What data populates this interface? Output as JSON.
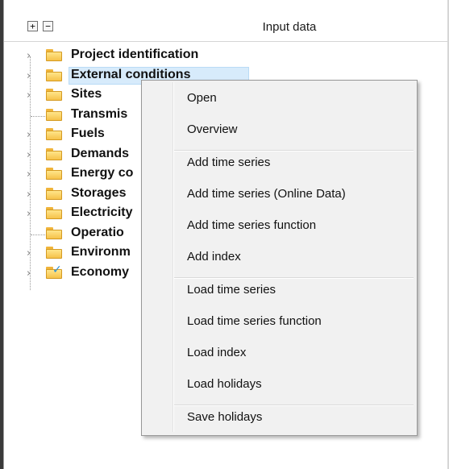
{
  "header": {
    "title": "Input data",
    "expand_label": "+",
    "collapse_label": "−"
  },
  "tree": [
    {
      "label": "Project identification",
      "expandable": true,
      "icon": "folder-icon",
      "selected": false
    },
    {
      "label": "External conditions",
      "expandable": true,
      "icon": "folder-icon",
      "selected": true
    },
    {
      "label": "Sites",
      "expandable": true,
      "icon": "folder-icon",
      "selected": false
    },
    {
      "label": "Transmis",
      "expandable": false,
      "icon": "folder-icon",
      "selected": false
    },
    {
      "label": "Fuels",
      "expandable": true,
      "icon": "folder-icon",
      "selected": false
    },
    {
      "label": "Demands",
      "expandable": true,
      "icon": "folder-icon",
      "selected": false
    },
    {
      "label": "Energy co",
      "expandable": true,
      "icon": "folder-icon",
      "selected": false
    },
    {
      "label": "Storages",
      "expandable": true,
      "icon": "folder-icon",
      "selected": false
    },
    {
      "label": "Electricity",
      "expandable": true,
      "icon": "folder-icon",
      "selected": false
    },
    {
      "label": "Operatio",
      "expandable": false,
      "icon": "folder-icon",
      "selected": false
    },
    {
      "label": "Environm",
      "expandable": true,
      "icon": "folder-icon",
      "selected": false
    },
    {
      "label": "Economy",
      "expandable": true,
      "icon": "checked-folder-icon",
      "selected": false
    }
  ],
  "context_menu": {
    "groups": [
      [
        "Open",
        "Overview"
      ],
      [
        "Add time series",
        "Add time series (Online Data)",
        "Add time series function",
        "Add index"
      ],
      [
        "Load time series",
        "Load time series function",
        "Load index",
        "Load holidays"
      ],
      [
        "Save holidays"
      ]
    ]
  },
  "colors": {
    "selection": "#d7ebfb",
    "folder": "#f6c24a",
    "menu_bg": "#f1f1f1"
  }
}
